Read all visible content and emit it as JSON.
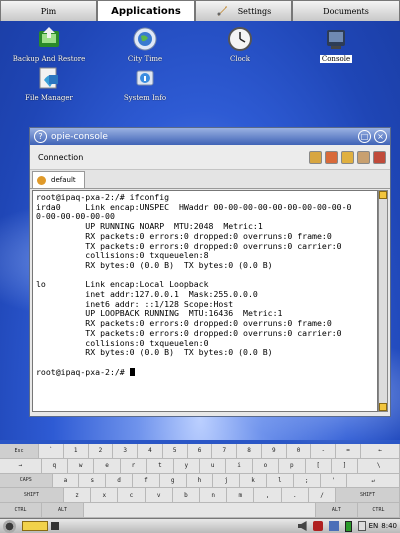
{
  "tabs": [
    {
      "label": "Pim",
      "active": false
    },
    {
      "label": "Applications",
      "active": true
    },
    {
      "label": "Settings",
      "active": false
    },
    {
      "label": "Documents",
      "active": false
    }
  ],
  "apps": [
    {
      "label": "Backup And Restore",
      "icon": "backup-icon",
      "selected": false
    },
    {
      "label": "City Time",
      "icon": "globe-clock-icon",
      "selected": false
    },
    {
      "label": "Clock",
      "icon": "clock-icon",
      "selected": false
    },
    {
      "label": "Console",
      "icon": "console-icon",
      "selected": true
    },
    {
      "label": "File Manager",
      "icon": "file-manager-icon",
      "selected": false
    },
    {
      "label": "System Info",
      "icon": "system-info-icon",
      "selected": false
    }
  ],
  "window": {
    "title": "opie-console",
    "menu_connection": "Connection",
    "session_tab": "default"
  },
  "terminal": {
    "lines": [
      "root@ipaq-pxa-2:/# ifconfig",
      "irda0     Link encap:UNSPEC  HWaddr 00-00-00-00-00-00-00-00-00-0",
      "0-00-00-00-00-00",
      "          UP RUNNING NOARP  MTU:2048  Metric:1",
      "          RX packets:0 errors:0 dropped:0 overruns:0 frame:0",
      "          TX packets:0 errors:0 dropped:0 overruns:0 carrier:0",
      "          collisions:0 txqueuelen:8",
      "          RX bytes:0 (0.0 B)  TX bytes:0 (0.0 B)",
      "",
      "lo        Link encap:Local Loopback",
      "          inet addr:127.0.0.1  Mask:255.0.0.0",
      "          inet6 addr: ::1/128 Scope:Host",
      "          UP LOOPBACK RUNNING  MTU:16436  Metric:1",
      "          RX packets:0 errors:0 dropped:0 overruns:0 frame:0",
      "          TX packets:0 errors:0 dropped:0 overruns:0 carrier:0",
      "          collisions:0 txqueuelen:0",
      "          RX bytes:0 (0.0 B)  TX bytes:0 (0.0 B)",
      "",
      "root@ipaq-pxa-2:/# "
    ]
  },
  "keyboard": {
    "rows": [
      [
        "Esc",
        "`",
        "1",
        "2",
        "3",
        "4",
        "5",
        "6",
        "7",
        "8",
        "9",
        "0",
        "-",
        "=",
        "←"
      ],
      [
        "→",
        "q",
        "w",
        "e",
        "r",
        "t",
        "y",
        "u",
        "i",
        "o",
        "p",
        "[",
        "]",
        "\\"
      ],
      [
        "CAPS",
        "a",
        "s",
        "d",
        "f",
        "g",
        "h",
        "j",
        "k",
        "l",
        ";",
        "'",
        "↵"
      ],
      [
        "SHIFT",
        "z",
        "x",
        "c",
        "v",
        "b",
        "n",
        "m",
        ",",
        ".",
        "/",
        "SHIFT"
      ],
      [
        "CTRL",
        "ALT",
        "",
        "ALT",
        "CTRL"
      ]
    ]
  },
  "taskbar": {
    "lang": "EN",
    "time": "8:40"
  },
  "colors": {
    "titlebar": "#3f63b6",
    "desktop": "#2a56c6"
  }
}
